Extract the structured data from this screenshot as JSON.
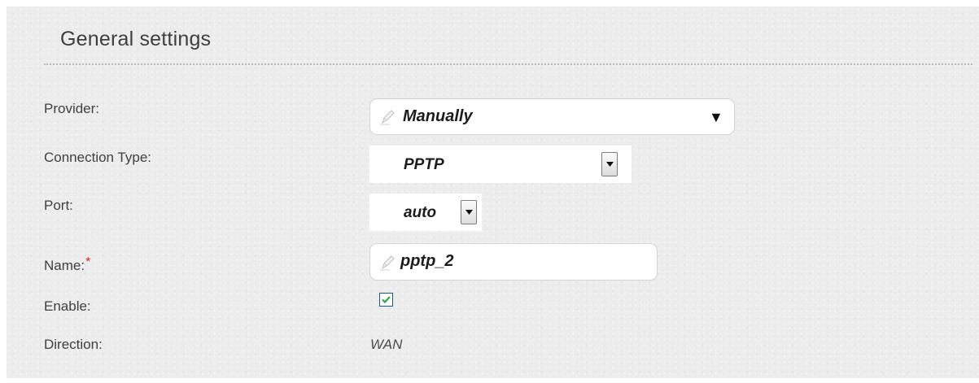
{
  "section": {
    "title": "General settings"
  },
  "fields": {
    "provider": {
      "label": "Provider:",
      "value": "Manually",
      "icon": "pencil-icon"
    },
    "connection_type": {
      "label": "Connection Type:",
      "value": "PPTP"
    },
    "port": {
      "label": "Port:",
      "value": "auto"
    },
    "name": {
      "label": "Name:",
      "required_marker": "*",
      "value": "pptp_2",
      "icon": "pencil-icon"
    },
    "enable": {
      "label": "Enable:",
      "checked": true
    },
    "direction": {
      "label": "Direction:",
      "value": "WAN"
    }
  },
  "colors": {
    "panel_background": "#ececec",
    "required": "#e02020",
    "checkbox_check": "#2ea84a"
  }
}
